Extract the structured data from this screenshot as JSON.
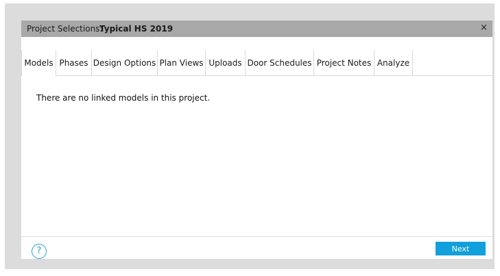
{
  "dialog": {
    "title_prefix": "Project Selections:",
    "project_name": "Typical HS 2019",
    "close_glyph": "×"
  },
  "tabs": [
    {
      "label": "Models",
      "active": true
    },
    {
      "label": "Phases",
      "active": false
    },
    {
      "label": "Design Options",
      "active": false
    },
    {
      "label": "Plan Views",
      "active": false
    },
    {
      "label": "Uploads",
      "active": false
    },
    {
      "label": "Door Schedules",
      "active": false
    },
    {
      "label": "Project Notes",
      "active": false
    },
    {
      "label": "Analyze",
      "active": false
    }
  ],
  "content": {
    "message": "There are no linked models in this project."
  },
  "footer": {
    "help_glyph": "?",
    "next_label": "Next"
  },
  "colors": {
    "accent": "#12a0dc",
    "titlebar": "#a8a8a8",
    "backdrop": "#dcdcdc"
  },
  "icons": [
    "close-icon",
    "help-icon"
  ]
}
